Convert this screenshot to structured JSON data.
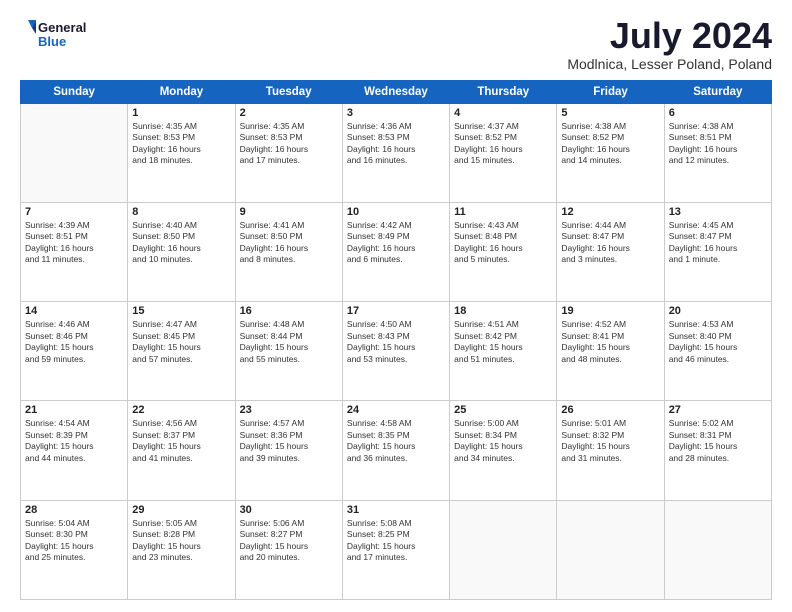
{
  "logo": {
    "line1": "General",
    "line2": "Blue"
  },
  "title": "July 2024",
  "location": "Modlnica, Lesser Poland, Poland",
  "days_header": [
    "Sunday",
    "Monday",
    "Tuesday",
    "Wednesday",
    "Thursday",
    "Friday",
    "Saturday"
  ],
  "weeks": [
    [
      {
        "day": "",
        "content": ""
      },
      {
        "day": "1",
        "content": "Sunrise: 4:35 AM\nSunset: 8:53 PM\nDaylight: 16 hours\nand 18 minutes."
      },
      {
        "day": "2",
        "content": "Sunrise: 4:35 AM\nSunset: 8:53 PM\nDaylight: 16 hours\nand 17 minutes."
      },
      {
        "day": "3",
        "content": "Sunrise: 4:36 AM\nSunset: 8:53 PM\nDaylight: 16 hours\nand 16 minutes."
      },
      {
        "day": "4",
        "content": "Sunrise: 4:37 AM\nSunset: 8:52 PM\nDaylight: 16 hours\nand 15 minutes."
      },
      {
        "day": "5",
        "content": "Sunrise: 4:38 AM\nSunset: 8:52 PM\nDaylight: 16 hours\nand 14 minutes."
      },
      {
        "day": "6",
        "content": "Sunrise: 4:38 AM\nSunset: 8:51 PM\nDaylight: 16 hours\nand 12 minutes."
      }
    ],
    [
      {
        "day": "7",
        "content": "Sunrise: 4:39 AM\nSunset: 8:51 PM\nDaylight: 16 hours\nand 11 minutes."
      },
      {
        "day": "8",
        "content": "Sunrise: 4:40 AM\nSunset: 8:50 PM\nDaylight: 16 hours\nand 10 minutes."
      },
      {
        "day": "9",
        "content": "Sunrise: 4:41 AM\nSunset: 8:50 PM\nDaylight: 16 hours\nand 8 minutes."
      },
      {
        "day": "10",
        "content": "Sunrise: 4:42 AM\nSunset: 8:49 PM\nDaylight: 16 hours\nand 6 minutes."
      },
      {
        "day": "11",
        "content": "Sunrise: 4:43 AM\nSunset: 8:48 PM\nDaylight: 16 hours\nand 5 minutes."
      },
      {
        "day": "12",
        "content": "Sunrise: 4:44 AM\nSunset: 8:47 PM\nDaylight: 16 hours\nand 3 minutes."
      },
      {
        "day": "13",
        "content": "Sunrise: 4:45 AM\nSunset: 8:47 PM\nDaylight: 16 hours\nand 1 minute."
      }
    ],
    [
      {
        "day": "14",
        "content": "Sunrise: 4:46 AM\nSunset: 8:46 PM\nDaylight: 15 hours\nand 59 minutes."
      },
      {
        "day": "15",
        "content": "Sunrise: 4:47 AM\nSunset: 8:45 PM\nDaylight: 15 hours\nand 57 minutes."
      },
      {
        "day": "16",
        "content": "Sunrise: 4:48 AM\nSunset: 8:44 PM\nDaylight: 15 hours\nand 55 minutes."
      },
      {
        "day": "17",
        "content": "Sunrise: 4:50 AM\nSunset: 8:43 PM\nDaylight: 15 hours\nand 53 minutes."
      },
      {
        "day": "18",
        "content": "Sunrise: 4:51 AM\nSunset: 8:42 PM\nDaylight: 15 hours\nand 51 minutes."
      },
      {
        "day": "19",
        "content": "Sunrise: 4:52 AM\nSunset: 8:41 PM\nDaylight: 15 hours\nand 48 minutes."
      },
      {
        "day": "20",
        "content": "Sunrise: 4:53 AM\nSunset: 8:40 PM\nDaylight: 15 hours\nand 46 minutes."
      }
    ],
    [
      {
        "day": "21",
        "content": "Sunrise: 4:54 AM\nSunset: 8:39 PM\nDaylight: 15 hours\nand 44 minutes."
      },
      {
        "day": "22",
        "content": "Sunrise: 4:56 AM\nSunset: 8:37 PM\nDaylight: 15 hours\nand 41 minutes."
      },
      {
        "day": "23",
        "content": "Sunrise: 4:57 AM\nSunset: 8:36 PM\nDaylight: 15 hours\nand 39 minutes."
      },
      {
        "day": "24",
        "content": "Sunrise: 4:58 AM\nSunset: 8:35 PM\nDaylight: 15 hours\nand 36 minutes."
      },
      {
        "day": "25",
        "content": "Sunrise: 5:00 AM\nSunset: 8:34 PM\nDaylight: 15 hours\nand 34 minutes."
      },
      {
        "day": "26",
        "content": "Sunrise: 5:01 AM\nSunset: 8:32 PM\nDaylight: 15 hours\nand 31 minutes."
      },
      {
        "day": "27",
        "content": "Sunrise: 5:02 AM\nSunset: 8:31 PM\nDaylight: 15 hours\nand 28 minutes."
      }
    ],
    [
      {
        "day": "28",
        "content": "Sunrise: 5:04 AM\nSunset: 8:30 PM\nDaylight: 15 hours\nand 25 minutes."
      },
      {
        "day": "29",
        "content": "Sunrise: 5:05 AM\nSunset: 8:28 PM\nDaylight: 15 hours\nand 23 minutes."
      },
      {
        "day": "30",
        "content": "Sunrise: 5:06 AM\nSunset: 8:27 PM\nDaylight: 15 hours\nand 20 minutes."
      },
      {
        "day": "31",
        "content": "Sunrise: 5:08 AM\nSunset: 8:25 PM\nDaylight: 15 hours\nand 17 minutes."
      },
      {
        "day": "",
        "content": ""
      },
      {
        "day": "",
        "content": ""
      },
      {
        "day": "",
        "content": ""
      }
    ]
  ]
}
